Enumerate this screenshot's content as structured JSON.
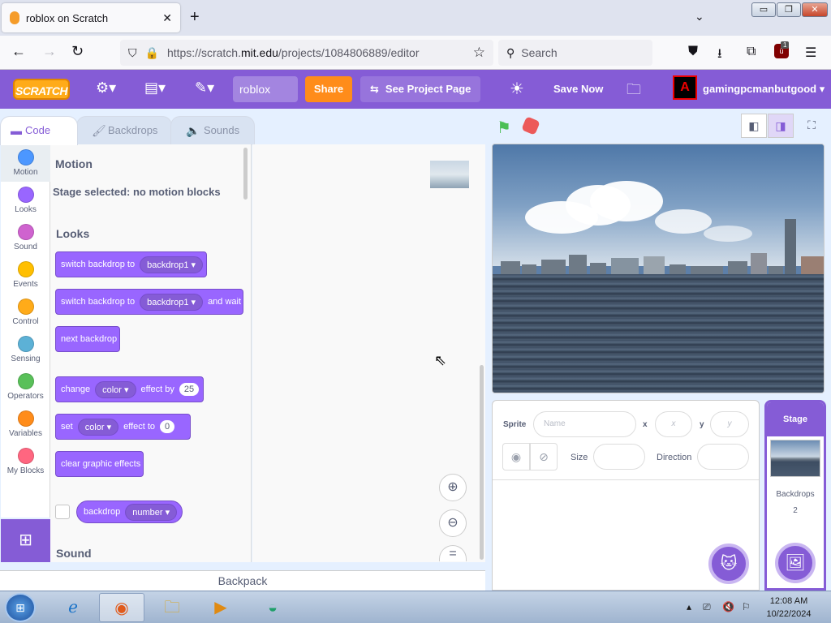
{
  "browser": {
    "tab_title": "roblox on Scratch",
    "tab_close": "✕",
    "new_tab": "+",
    "tablist": "⌄",
    "window_controls": [
      "▭",
      "❐",
      "✕"
    ],
    "url_host_prefix": "https://scratch.",
    "url_host": "mit.edu",
    "url_path": "/projects/1084806889/editor",
    "search_placeholder": "Search",
    "ublock_count": "1"
  },
  "menubar": {
    "logo": "SCRATCH",
    "project_title": "roblox",
    "share": "Share",
    "see_project_page": "See Project Page",
    "save_now": "Save Now",
    "avatar_letter": "A",
    "username": "gamingpcmanbutgood",
    "username_caret": "▾"
  },
  "editor_tabs": [
    {
      "label": "Code",
      "icon": "code-icon"
    },
    {
      "label": "Backdrops",
      "icon": "brush-icon"
    },
    {
      "label": "Sounds",
      "icon": "speaker-icon"
    }
  ],
  "categories": [
    {
      "label": "Motion",
      "color": "#4c97ff"
    },
    {
      "label": "Looks",
      "color": "#9966ff"
    },
    {
      "label": "Sound",
      "color": "#cf63cf"
    },
    {
      "label": "Events",
      "color": "#ffbf00"
    },
    {
      "label": "Control",
      "color": "#ffab19"
    },
    {
      "label": "Sensing",
      "color": "#5cb1d6"
    },
    {
      "label": "Operators",
      "color": "#59c059"
    },
    {
      "label": "Variables",
      "color": "#ff8c1a"
    },
    {
      "label": "My Blocks",
      "color": "#ff6680"
    }
  ],
  "palette": {
    "motion_heading": "Motion",
    "motion_note": "Stage selected: no motion blocks",
    "looks_heading": "Looks",
    "sound_heading": "Sound",
    "blocks": {
      "switch_backdrop": {
        "text": "switch backdrop to",
        "menu": "backdrop1"
      },
      "switch_backdrop_wait": {
        "text": "switch backdrop to",
        "menu": "backdrop1",
        "suffix": "and wait"
      },
      "next_backdrop": {
        "text": "next backdrop"
      },
      "change_effect": {
        "text": "change",
        "menu": "color",
        "mid": "effect by",
        "value": "25"
      },
      "set_effect": {
        "text": "set",
        "menu": "color",
        "mid": "effect to",
        "value": "0"
      },
      "clear_effects": {
        "text": "clear graphic effects"
      },
      "backdrop_reporter": {
        "text": "backdrop",
        "menu": "number"
      }
    }
  },
  "backpack": "Backpack",
  "sprite_info": {
    "sprite_label": "Sprite",
    "name_placeholder": "Name",
    "x_label": "x",
    "x_placeholder": "x",
    "y_label": "y",
    "y_placeholder": "y",
    "size_label": "Size",
    "direction_label": "Direction"
  },
  "stage_target": {
    "header": "Stage",
    "backdrops_label": "Backdrops",
    "backdrops_count": "2"
  },
  "taskbar": {
    "time": "12:08 AM",
    "date": "10/22/2024"
  },
  "colors": {
    "scratch_purple": "#855cd6",
    "looks_block": "#9966ff",
    "share_orange": "#ff8c1a",
    "green_flag": "#4cbf56",
    "stop_red": "#ec5959"
  }
}
